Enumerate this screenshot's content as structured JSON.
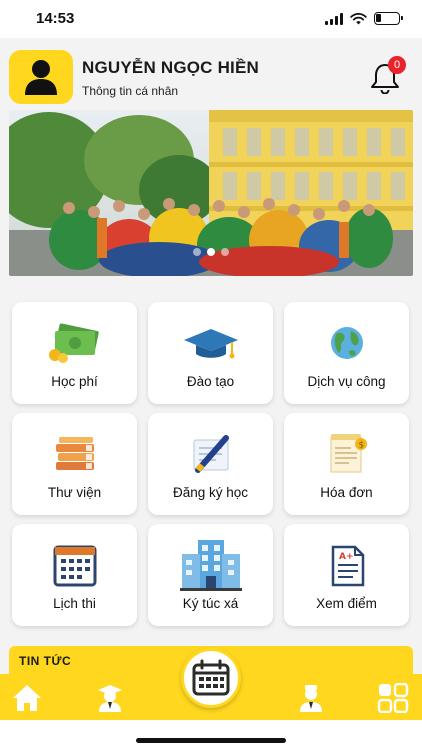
{
  "status": {
    "time": "14:53"
  },
  "profile": {
    "name": "NGUYỄN NGỌC HIỀN",
    "subtitle": "Thông tin cá nhân",
    "notification_count": "0"
  },
  "banner": {
    "slides": 3,
    "active_slide": 2
  },
  "menu": [
    {
      "label": "Học phí",
      "icon": "money-icon"
    },
    {
      "label": "Đào tạo",
      "icon": "graduation-cap-icon"
    },
    {
      "label": "Dịch vụ công",
      "icon": "globe-icon"
    },
    {
      "label": "Thư viện",
      "icon": "books-icon"
    },
    {
      "label": "Đăng ký học",
      "icon": "pen-paper-icon"
    },
    {
      "label": "Hóa đơn",
      "icon": "invoice-icon"
    },
    {
      "label": "Lịch thi",
      "icon": "calendar-icon"
    },
    {
      "label": "Ký túc xá",
      "icon": "dormitory-icon"
    },
    {
      "label": "Xem điểm",
      "icon": "grade-report-icon"
    }
  ],
  "news": {
    "title": "TIN TỨC"
  },
  "tabbar": {
    "items": [
      "home-icon",
      "student-icon",
      "calendar-icon",
      "teacher-icon",
      "grid-menu-icon"
    ],
    "colors": {
      "accent": "#fed71e",
      "badge": "#e8232a"
    }
  }
}
